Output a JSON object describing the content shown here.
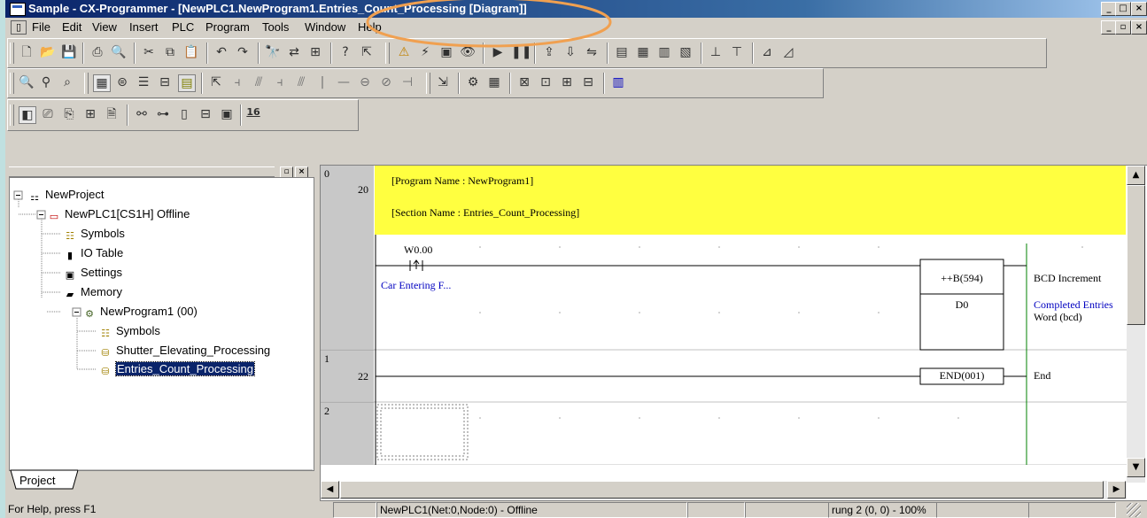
{
  "window": {
    "title": "Sample - CX-Programmer - [NewPLC1.NewProgram1.Entries_Count_Processing [Diagram]]",
    "controls": [
      "_",
      "□",
      "×"
    ],
    "child_controls": [
      "_",
      "▫",
      "×"
    ]
  },
  "menu": [
    "File",
    "Edit",
    "View",
    "Insert",
    "PLC",
    "Program",
    "Tools",
    "Window",
    "Help"
  ],
  "toolbar_labels": {
    "sixteen": "16"
  },
  "project_panel": {
    "tab": "Project",
    "tree": [
      {
        "label": "NewProject",
        "icon": "project-icon"
      },
      {
        "label": "NewPLC1[CS1H] Offline",
        "icon": "plc-icon"
      },
      {
        "label": "Symbols",
        "icon": "symbols-icon"
      },
      {
        "label": "IO Table",
        "icon": "io-table-icon"
      },
      {
        "label": "Settings",
        "icon": "settings-icon"
      },
      {
        "label": "Memory",
        "icon": "memory-icon"
      },
      {
        "label": "NewProgram1 (00)",
        "icon": "program-icon"
      },
      {
        "label": "Symbols",
        "icon": "symbols-icon"
      },
      {
        "label": "Shutter_Elevating_Processing",
        "icon": "section-icon"
      },
      {
        "label": "Entries_Count_Processing",
        "icon": "section-icon"
      }
    ]
  },
  "diagram": {
    "header_comment": {
      "program_name": "[Program Name : NewProgram1]",
      "section_name": "[Section Name : Entries_Count_Processing]"
    },
    "rungs": [
      {
        "number": "0",
        "step": "20"
      },
      {
        "number": "1",
        "step": "22"
      },
      {
        "number": "2",
        "step": ""
      }
    ],
    "contact": {
      "address": "W0.00",
      "comment": "Car Entering F..."
    },
    "instruction": {
      "mnemonic": "++B(594)",
      "operand": "D0",
      "description": "BCD Increment",
      "operand_comment_line1": "Completed Entries",
      "operand_comment_line2": "Word (bcd)"
    },
    "end_instruction": {
      "mnemonic": "END(001)",
      "description": "End"
    }
  },
  "status_bar": {
    "help": "For Help, press F1",
    "connection": "NewPLC1(Net:0,Node:0) - Offline",
    "position": "rung 2 (0, 0)  - 100%"
  },
  "colors": {
    "title_gradient_start": "#0a246a",
    "comment_yellow": "#ffff40",
    "annotation_orange": "#f0a050",
    "power_rail": "#008000"
  }
}
